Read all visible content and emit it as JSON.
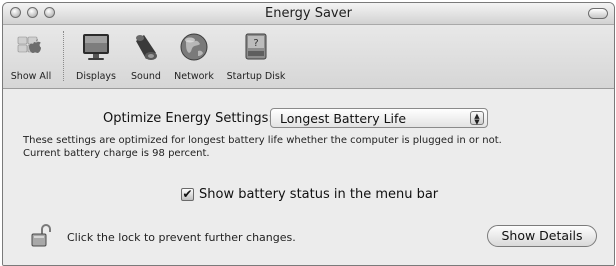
{
  "window": {
    "title": "Energy Saver"
  },
  "toolbar": {
    "items": [
      {
        "label": "Show All",
        "icon": "apple-logo-icon"
      },
      {
        "label": "Displays",
        "icon": "display-icon"
      },
      {
        "label": "Sound",
        "icon": "speaker-icon"
      },
      {
        "label": "Network",
        "icon": "globe-icon"
      },
      {
        "label": "Startup Disk",
        "icon": "disk-icon"
      }
    ]
  },
  "energy": {
    "optimize_label": "Optimize Energy Settings:",
    "optimize_value": "Longest Battery Life",
    "description_line1": "These settings are optimized for longest battery life whether the computer is plugged in or not.",
    "description_line2": "Current battery charge is 98 percent.",
    "show_status_label": "Show battery status in the menu bar",
    "show_status_checked": true
  },
  "footer": {
    "lock_text": "Click the lock to prevent further changes.",
    "details_button": "Show Details"
  }
}
